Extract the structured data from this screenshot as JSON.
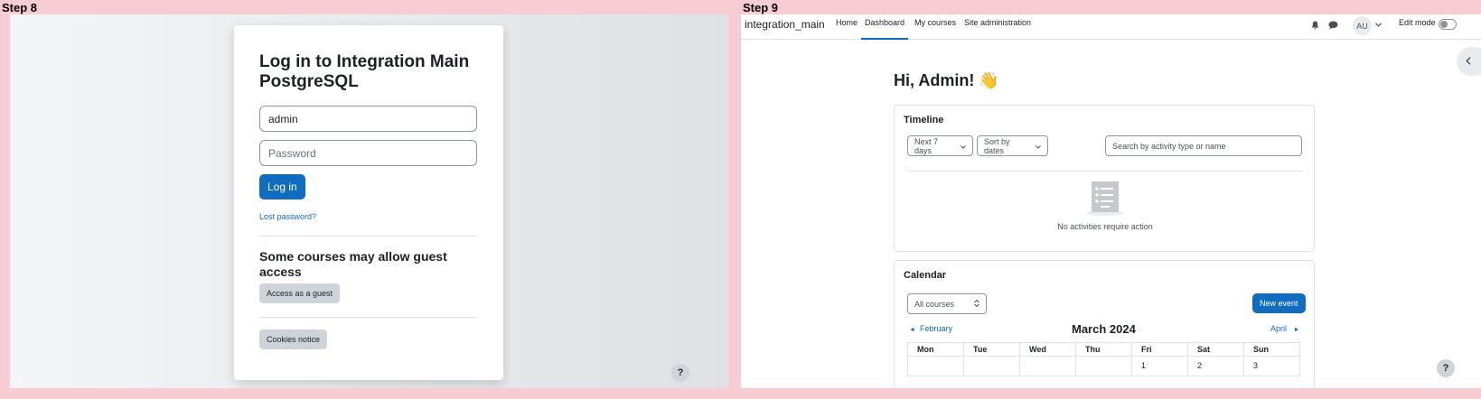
{
  "steps": {
    "left_label": "Step 8",
    "right_label": "Step 9"
  },
  "login": {
    "title": "Log in to Integration Main PostgreSQL",
    "username_value": "admin",
    "password_placeholder": "Password",
    "login_button": "Log in",
    "lost_password": "Lost password?",
    "guest_heading": "Some courses may allow guest access",
    "guest_button": "Access as a guest",
    "cookies_button": "Cookies notice",
    "help": "?"
  },
  "dashboard": {
    "navbar": {
      "brand": "integration_main",
      "items": [
        "Home",
        "Dashboard",
        "My courses",
        "Site administration"
      ],
      "active_item": "Dashboard",
      "avatar": "AU",
      "edit_mode": "Edit mode",
      "edit_mode_on": false
    },
    "greeting": "Hi, Admin! 👋",
    "timeline": {
      "title": "Timeline",
      "filter_days": "Next 7 days",
      "sort": "Sort by dates",
      "search_placeholder": "Search by activity type or name",
      "empty_text": "No activities require action"
    },
    "calendar": {
      "title": "Calendar",
      "course_filter": "All courses",
      "new_event": "New event",
      "prev_month": "February",
      "month": "March 2024",
      "next_month": "April",
      "weekdays": [
        "Mon",
        "Tue",
        "Wed",
        "Thu",
        "Fri",
        "Sat",
        "Sun"
      ],
      "first_week": [
        "",
        "",
        "",
        "",
        "1",
        "2",
        "3"
      ]
    },
    "help": "?"
  },
  "colors": {
    "background": "#f7ccd2",
    "primary": "#0f6cbf",
    "text": "#1d2125",
    "secondary_button": "#ced4da"
  }
}
